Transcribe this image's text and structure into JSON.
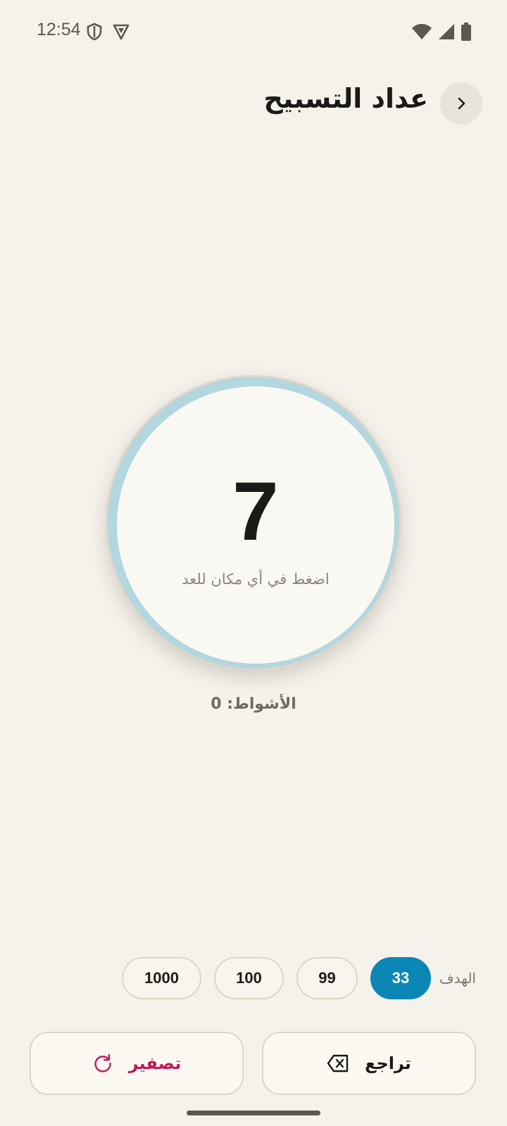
{
  "status_bar": {
    "time": "12:54",
    "icons": [
      "shield-icon",
      "vpn-icon",
      "wifi-icon",
      "signal-icon",
      "battery-icon"
    ]
  },
  "header": {
    "title": "عداد التسبيح",
    "back_icon": "chevron-right-icon"
  },
  "counter": {
    "count": "7",
    "hint": "اضغط في أي مكان للعد",
    "ring_color": "#b3d6df"
  },
  "rounds": {
    "label": "الأشواط: 0"
  },
  "goal": {
    "label": "الهدف",
    "options": [
      "33",
      "99",
      "100",
      "1000"
    ],
    "selected": "33",
    "accent_color": "#0b86b5"
  },
  "actions": {
    "undo_label": "تراجع",
    "undo_icon": "backspace-icon",
    "reset_label": "تصفير",
    "reset_icon": "refresh-icon",
    "reset_color": "#c2185b"
  }
}
